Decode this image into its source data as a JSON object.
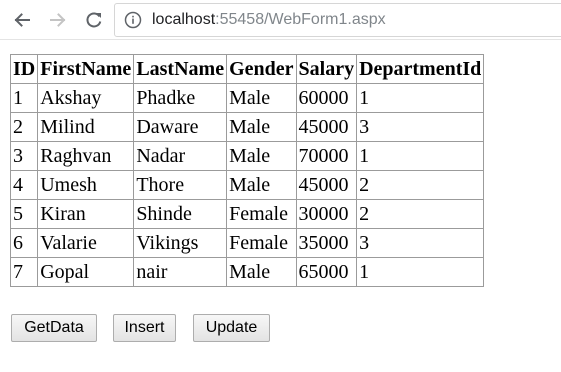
{
  "browser": {
    "url_host": "localhost",
    "url_path": ":55458/WebForm1.aspx",
    "icons": {
      "back": "back-arrow-icon",
      "forward": "forward-arrow-icon",
      "reload": "reload-icon",
      "info": "info-icon"
    }
  },
  "table": {
    "headers": [
      "ID",
      "FirstName",
      "LastName",
      "Gender",
      "Salary",
      "DepartmentId"
    ],
    "rows": [
      [
        "1",
        "Akshay",
        "Phadke",
        "Male",
        "60000",
        "1"
      ],
      [
        "2",
        "Milind",
        "Daware",
        "Male",
        "45000",
        "3"
      ],
      [
        "3",
        "Raghvan",
        "Nadar",
        "Male",
        "70000",
        "1"
      ],
      [
        "4",
        "Umesh",
        "Thore",
        "Male",
        "45000",
        "2"
      ],
      [
        "5",
        "Kiran",
        "Shinde",
        "Female",
        "30000",
        "2"
      ],
      [
        "6",
        "Valarie",
        "Vikings",
        "Female",
        "35000",
        "3"
      ],
      [
        "7",
        "Gopal",
        "nair",
        "Male",
        "65000",
        "1"
      ]
    ]
  },
  "buttons": {
    "getdata": "GetData",
    "insert": "Insert",
    "update": "Update"
  }
}
